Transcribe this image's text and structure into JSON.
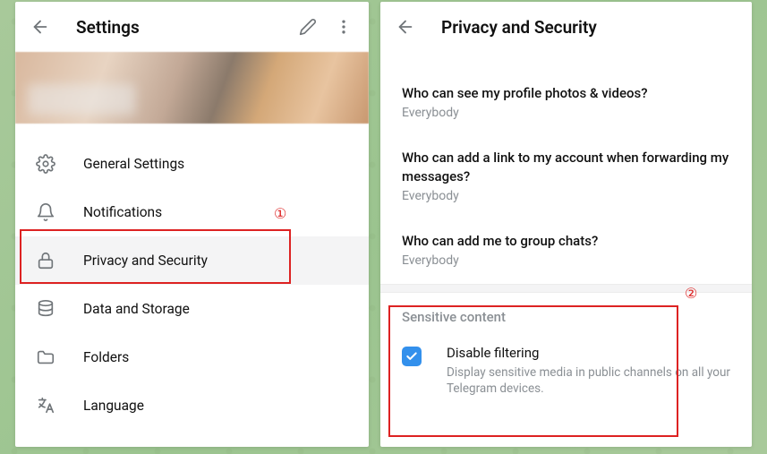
{
  "settings": {
    "title": "Settings",
    "items": [
      {
        "icon": "gear",
        "label": "General Settings"
      },
      {
        "icon": "bell",
        "label": "Notifications"
      },
      {
        "icon": "lock",
        "label": "Privacy and Security"
      },
      {
        "icon": "storage",
        "label": "Data and Storage"
      },
      {
        "icon": "folder",
        "label": "Folders"
      },
      {
        "icon": "language",
        "label": "Language"
      }
    ],
    "active_index": 2
  },
  "privacy": {
    "title": "Privacy and Security",
    "options": [
      {
        "title": "Who can see my profile photos & videos?",
        "value": "Everybody"
      },
      {
        "title": "Who can add a link to my account when forwarding my messages?",
        "value": "Everybody"
      },
      {
        "title": "Who can add me to group chats?",
        "value": "Everybody"
      }
    ],
    "sensitive_section": "Sensitive content",
    "disable_filtering": {
      "checked": true,
      "label": "Disable filtering",
      "desc": "Display sensitive media in public channels on all your Telegram devices."
    }
  },
  "annotations": {
    "one": "①",
    "two": "②"
  }
}
